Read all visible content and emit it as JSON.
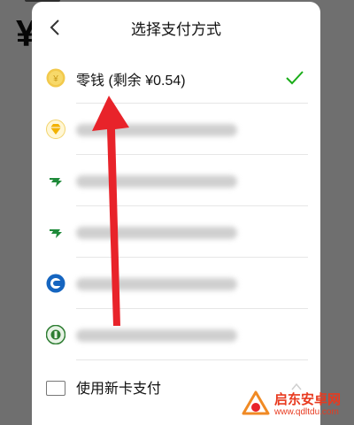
{
  "background": {
    "currency_symbol": "¥"
  },
  "sheet": {
    "title": "选择支付方式",
    "back_icon": "chevron-left-icon"
  },
  "payment_methods": [
    {
      "label": "零钱 (剩余 ¥0.54)",
      "icon": "coin-icon",
      "icon_color": "#f2c94c",
      "selected": true,
      "obscured": false
    },
    {
      "label": "",
      "icon": "diamond-bank-icon",
      "icon_color": "#f2b200",
      "selected": false,
      "obscured": true
    },
    {
      "label": "",
      "icon": "postal-bank-icon",
      "icon_color": "#1f8a3a",
      "selected": false,
      "obscured": true
    },
    {
      "label": "",
      "icon": "postal-bank-icon",
      "icon_color": "#1f8a3a",
      "selected": false,
      "obscured": true
    },
    {
      "label": "",
      "icon": "ccb-bank-icon",
      "icon_color": "#1565c0",
      "selected": false,
      "obscured": true
    },
    {
      "label": "",
      "icon": "rural-bank-icon",
      "icon_color": "#2e7d32",
      "selected": false,
      "obscured": true
    }
  ],
  "new_card": {
    "label": "使用新卡支付",
    "icon": "card-icon"
  },
  "colors": {
    "check": "#1aad19",
    "annotation_arrow": "#e8232a"
  },
  "watermark": {
    "title": "启东安卓网",
    "url": "www.qdltdu.com"
  }
}
